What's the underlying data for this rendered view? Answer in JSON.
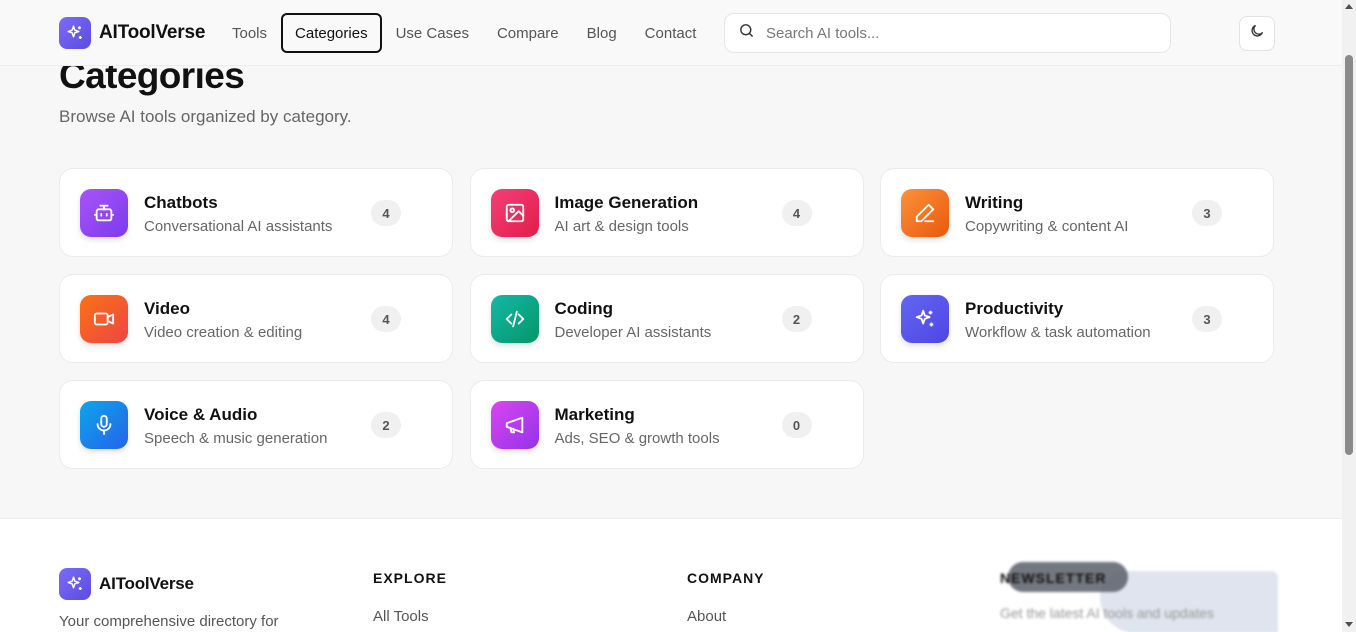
{
  "brand": {
    "name": "AIToolVerse"
  },
  "nav": {
    "items": [
      {
        "label": "Tools"
      },
      {
        "label": "Categories"
      },
      {
        "label": "Use Cases"
      },
      {
        "label": "Compare"
      },
      {
        "label": "Blog"
      },
      {
        "label": "Contact"
      }
    ],
    "active": "Categories"
  },
  "search": {
    "placeholder": "Search AI tools...",
    "value": ""
  },
  "page": {
    "title": "Categories",
    "subtitle": "Browse AI tools organized by category."
  },
  "categories": [
    {
      "name": "Chatbots",
      "description": "Conversational AI assistants",
      "count": "4",
      "icon": "bot-icon",
      "color_from": "#a855f7",
      "color_to": "#7c3aed"
    },
    {
      "name": "Image Generation",
      "description": "AI art & design tools",
      "count": "4",
      "icon": "image-icon",
      "color_from": "#f43f7a",
      "color_to": "#e11d48"
    },
    {
      "name": "Writing",
      "description": "Copywriting & content AI",
      "count": "3",
      "icon": "pen-icon",
      "color_from": "#fb923c",
      "color_to": "#ea580c"
    },
    {
      "name": "Video",
      "description": "Video creation & editing",
      "count": "4",
      "icon": "video-icon",
      "color_from": "#f97316",
      "color_to": "#ef4444"
    },
    {
      "name": "Coding",
      "description": "Developer AI assistants",
      "count": "2",
      "icon": "code-icon",
      "color_from": "#14b8a6",
      "color_to": "#059669"
    },
    {
      "name": "Productivity",
      "description": "Workflow & task automation",
      "count": "3",
      "icon": "sparkles-icon",
      "color_from": "#6366f1",
      "color_to": "#4f46e5"
    },
    {
      "name": "Voice & Audio",
      "description": "Speech & music generation",
      "count": "2",
      "icon": "mic-icon",
      "color_from": "#0ea5e9",
      "color_to": "#2563eb"
    },
    {
      "name": "Marketing",
      "description": "Ads, SEO & growth tools",
      "count": "0",
      "icon": "megaphone-icon",
      "color_from": "#d946ef",
      "color_to": "#9333ea"
    }
  ],
  "footer": {
    "brand": "AIToolVerse",
    "description": "Your comprehensive directory for",
    "explore": {
      "title": "EXPLORE",
      "links": [
        "All Tools"
      ]
    },
    "company": {
      "title": "COMPANY",
      "links": [
        "About"
      ]
    },
    "newsletter": {
      "title": "NEWSLETTER",
      "text": "Get the latest AI tools and updates"
    }
  },
  "colors": {
    "accent": "#6d5cf0",
    "background": "#f7f7f7",
    "card": "#ffffff"
  }
}
